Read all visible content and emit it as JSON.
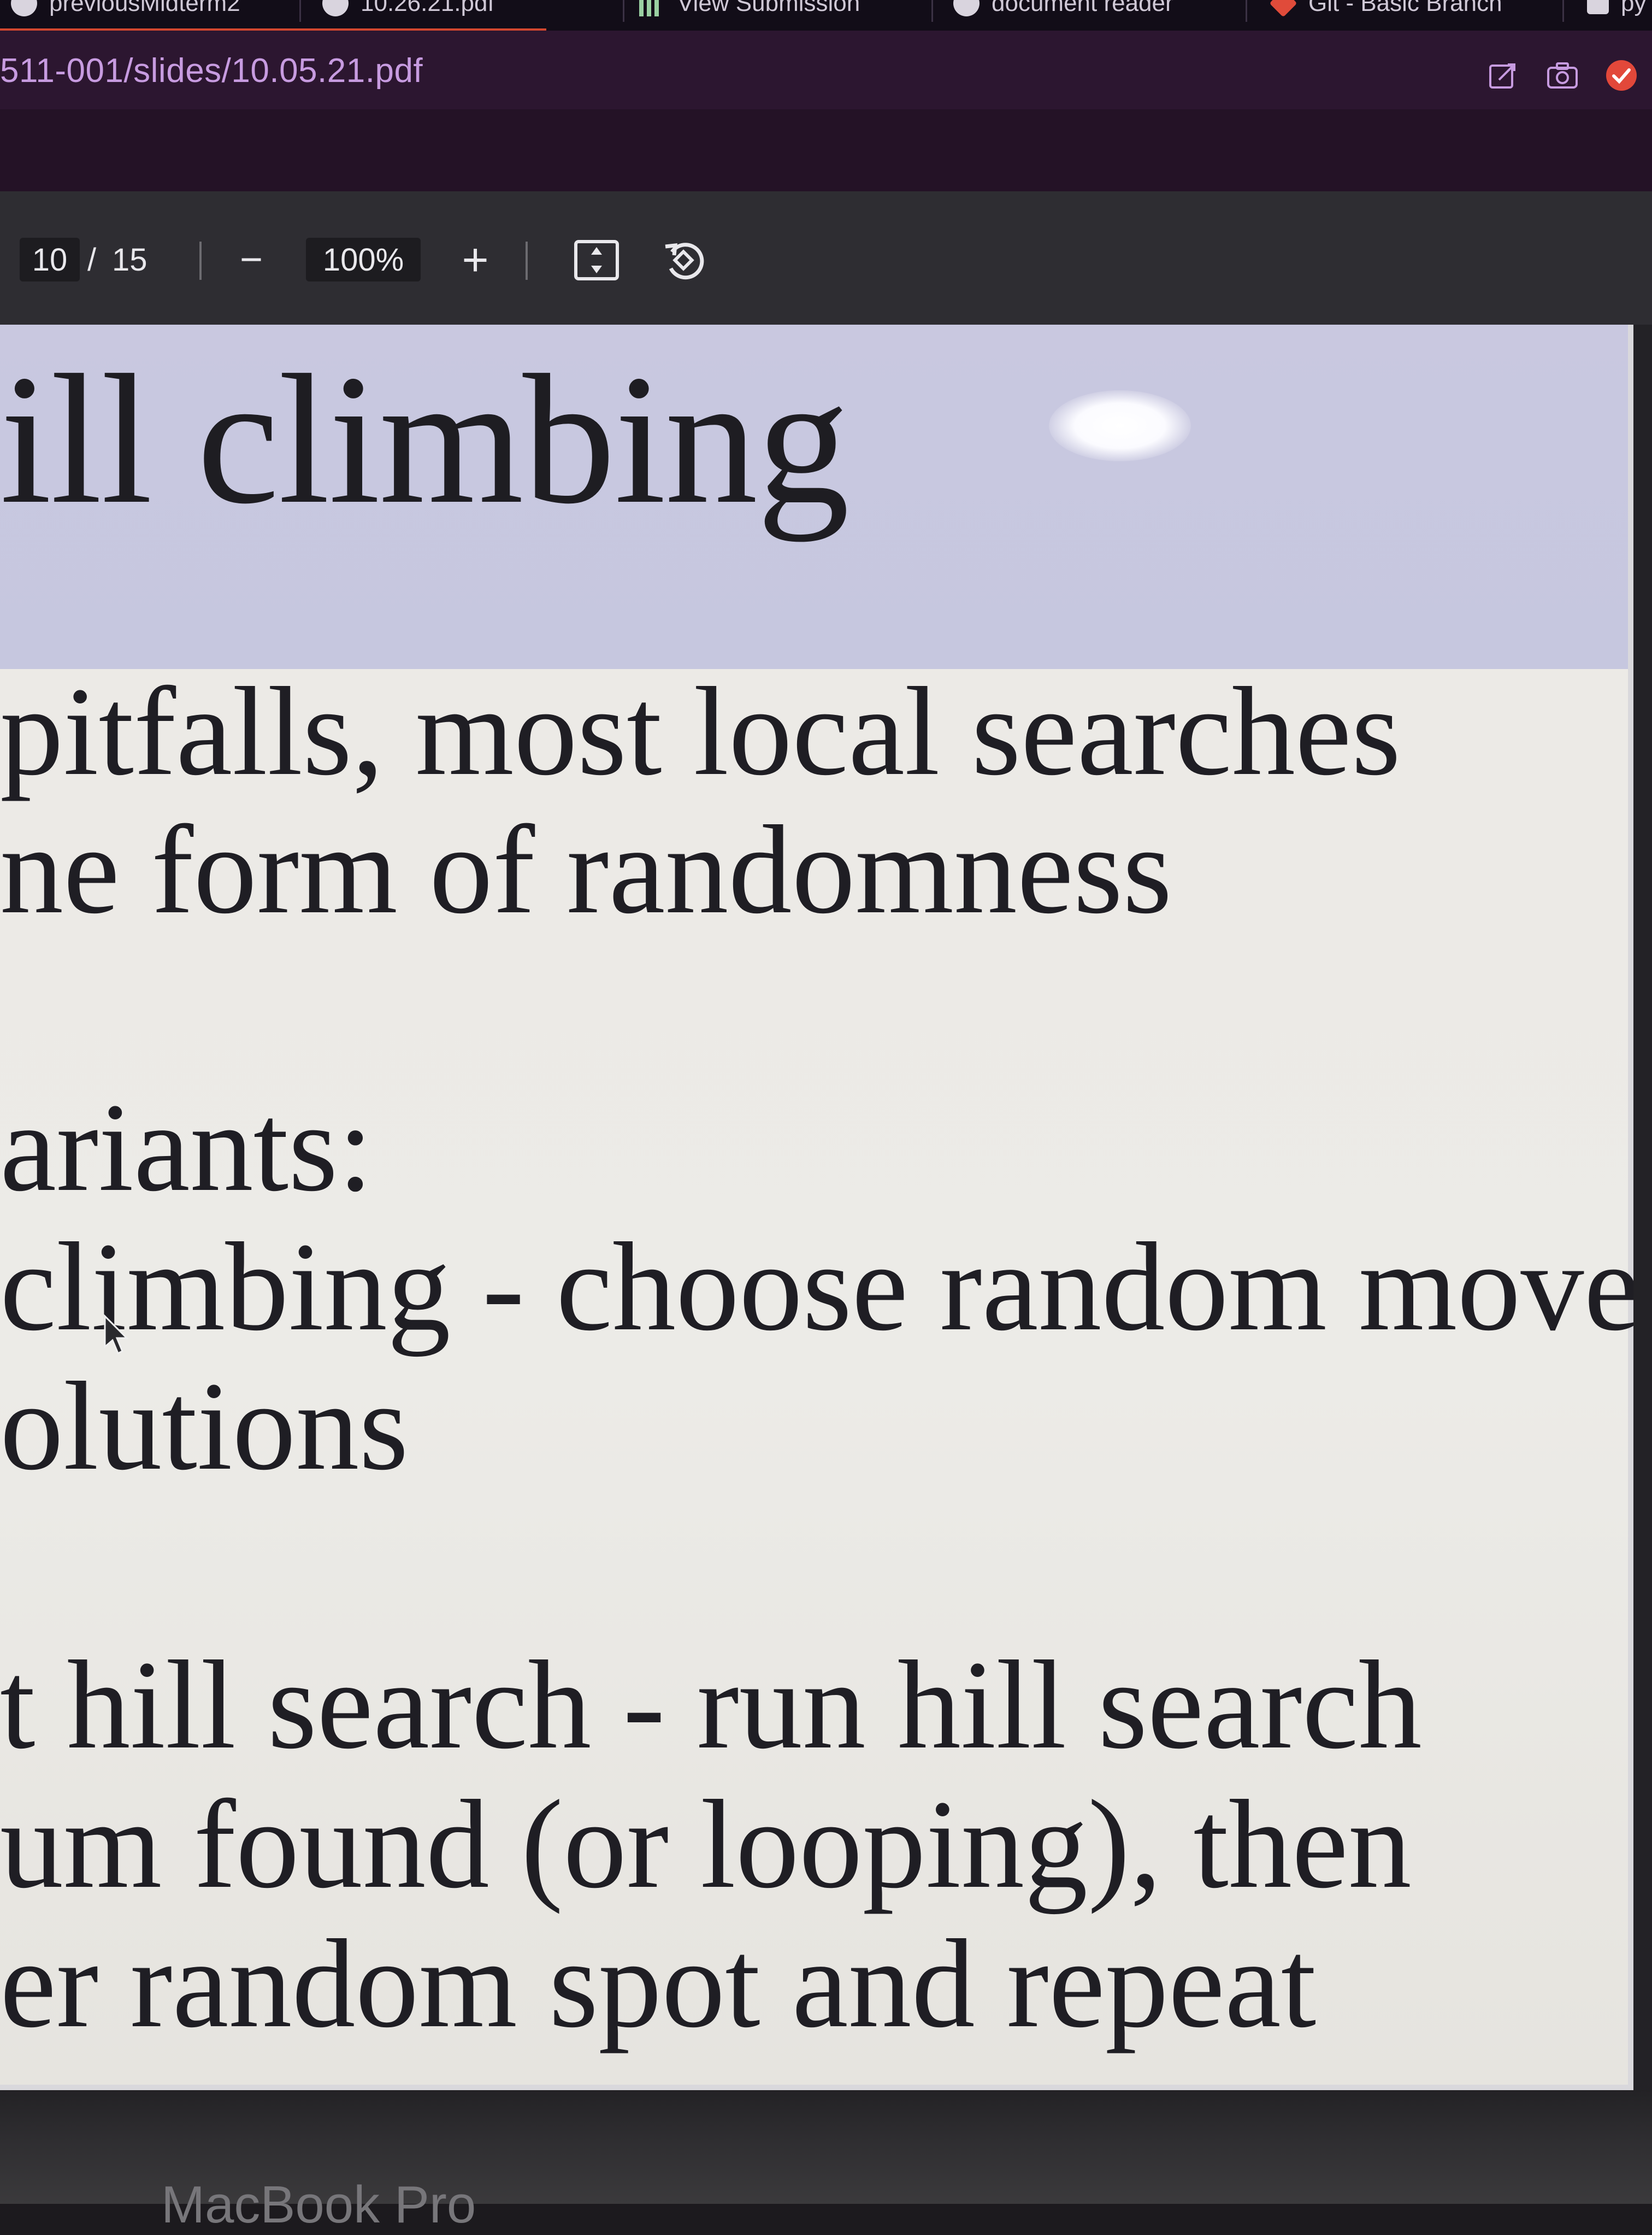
{
  "browser": {
    "tabs": [
      {
        "label": "previousMidterm2"
      },
      {
        "label": "10.26.21.pdf"
      },
      {
        "label": "View Submission"
      },
      {
        "label": "document reader"
      },
      {
        "label": "Git - Basic Branch"
      },
      {
        "label": "py"
      }
    ],
    "url": "511-001/slides/10.05.21.pdf",
    "accent_color": "#d2472f"
  },
  "pdf_toolbar": {
    "page_current": "10",
    "page_separator": "/",
    "page_total": "15",
    "zoom_out_label": "−",
    "zoom_value": "100%",
    "zoom_in_label": "+"
  },
  "slide": {
    "title": "ill climbing",
    "lines": [
      "pitfalls, most local searches",
      "ne form of randomness",
      "ariants:",
      "climbing - choose random move",
      "olutions",
      "t hill search - run hill search",
      "um found (or looping), then",
      "er random spot and repeat"
    ],
    "header_color": "#c9c8e0",
    "body_color": "#eceae6"
  },
  "device": {
    "bezel_label": "MacBook Pro"
  }
}
